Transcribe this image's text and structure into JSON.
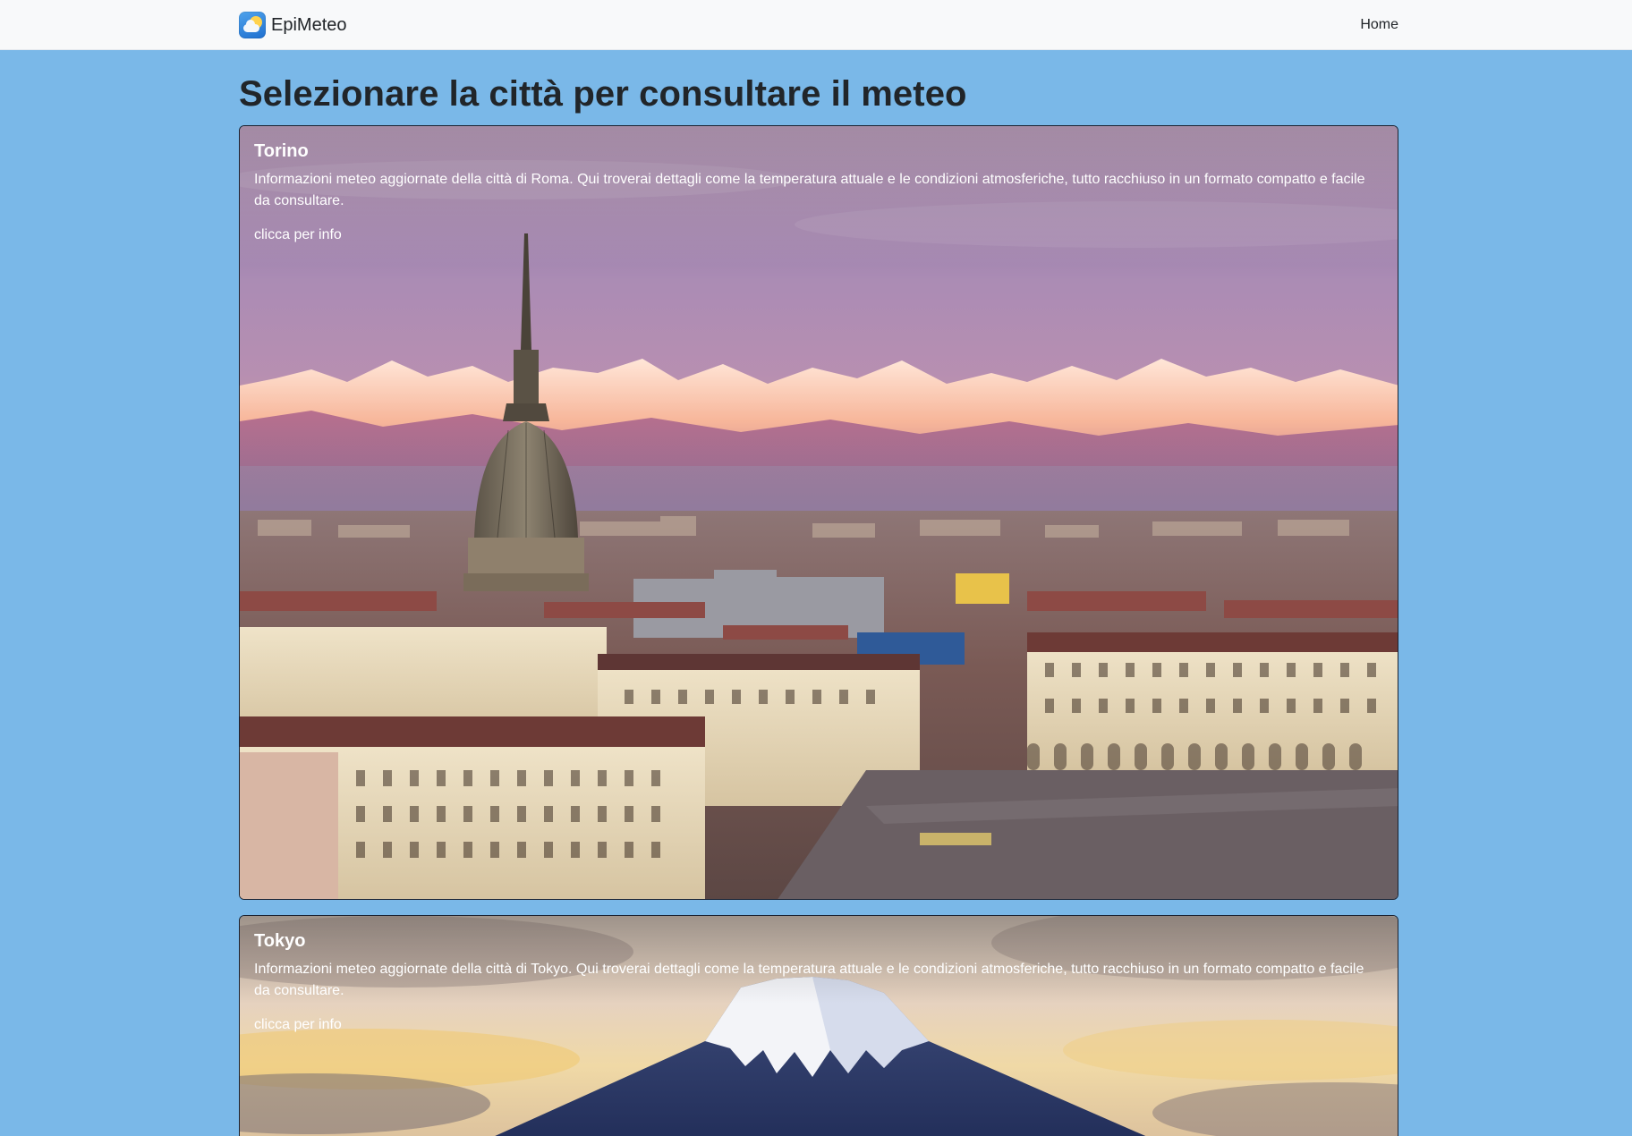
{
  "navbar": {
    "brand": "EpiMeteo",
    "home_link": "Home"
  },
  "page_title": "Selezionare la città per consultare il meteo",
  "cities": [
    {
      "name": "Torino",
      "description": "Informazioni meteo aggiornate della città di Roma. Qui troverai dettagli come la temperatura attuale e le condizioni atmosferiche, tutto racchiuso in un formato compatto e facile da consultare.",
      "link": "clicca per info"
    },
    {
      "name": "Tokyo",
      "description": "Informazioni meteo aggiornate della città di Tokyo. Qui troverai dettagli come la temperatura attuale e le condizioni atmosferiche, tutto racchiuso in un formato compatto e facile da consultare.",
      "link": "clicca per info"
    }
  ],
  "colors": {
    "page_background": "#7ab8e8",
    "navbar_background": "#f8f9fa",
    "text_dark": "#212529",
    "card_text": "#ffffff"
  }
}
